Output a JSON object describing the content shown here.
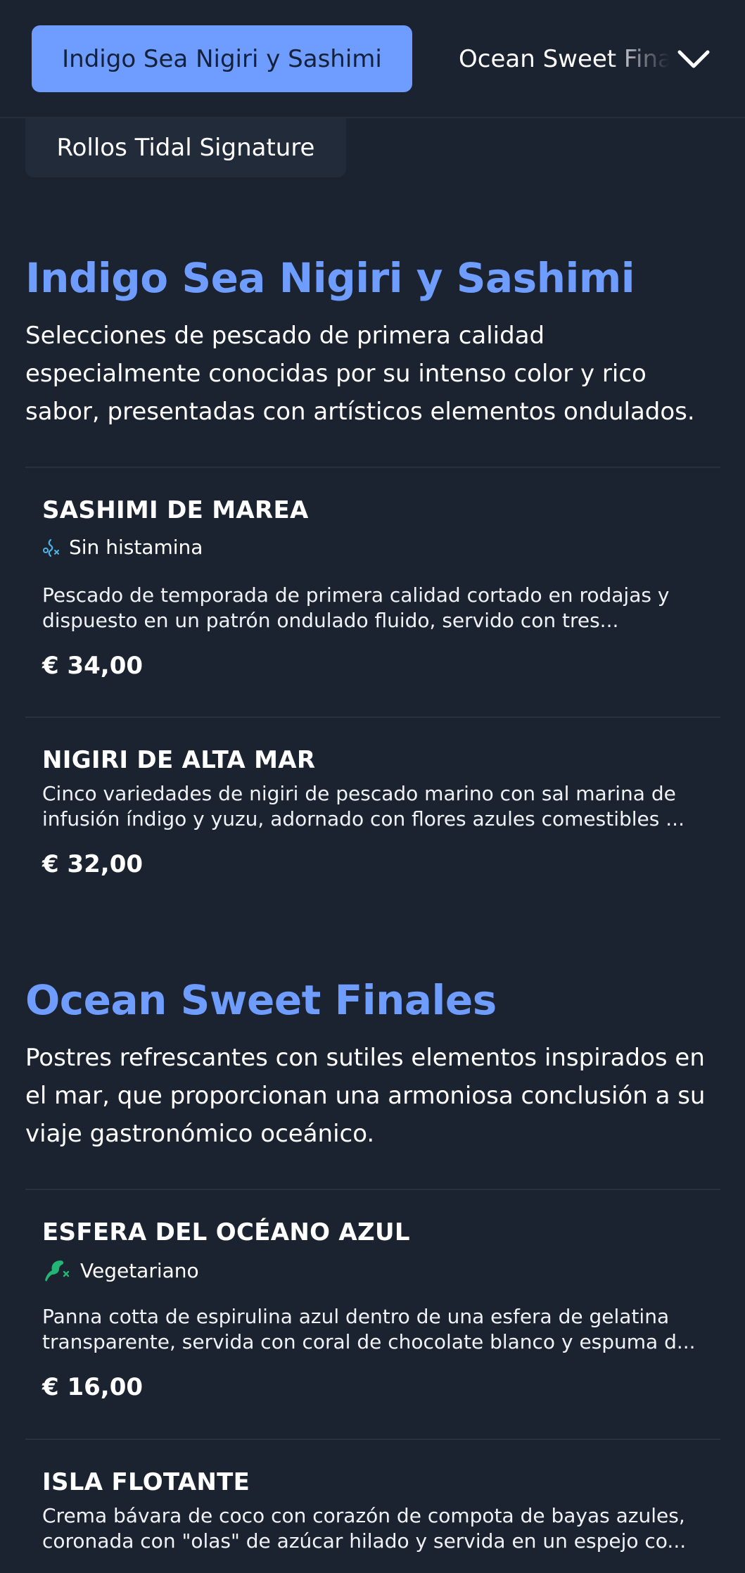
{
  "nav": {
    "active_label": "Indigo Sea Nigiri y Sashimi",
    "next_label": "Ocean Sweet Finales",
    "second_row_label": "Rollos Tidal Signature"
  },
  "sections": [
    {
      "title": "Indigo Sea Nigiri y Sashimi",
      "description_lines": [
        "Selecciones de pescado de primera calidad",
        "especialmente conocidas por su intenso color y rico",
        "sabor, presentadas con artísticos elementos ondulados."
      ],
      "items": [
        {
          "name": "SASHIMI DE MAREA",
          "tag": "Sin histamina",
          "tag_icon": "histamine-free-icon",
          "description_lines": [
            "Pescado de temporada de primera calidad cortado en rodajas y",
            "dispuesto en un patrón ondulado fluido, servido con tres..."
          ],
          "price": "€ 34,00"
        },
        {
          "name": "NIGIRI DE ALTA MAR",
          "description_lines": [
            "Cinco variedades de nigiri de pescado marino con sal marina de",
            "infusión índigo y yuzu, adornado con flores azules comestibles ..."
          ],
          "price": "€ 32,00"
        }
      ]
    },
    {
      "title": "Ocean Sweet Finales",
      "description_lines": [
        "Postres refrescantes con sutiles elementos inspirados en",
        "el mar, que proporcionan una armoniosa conclusión a su",
        "viaje gastronómico oceánico."
      ],
      "items": [
        {
          "name": "ESFERA DEL OCÉANO AZUL",
          "tag": "Vegetariano",
          "tag_icon": "vegetarian-icon",
          "description_lines": [
            "Panna cotta de espirulina azul dentro de una esfera de gelatina",
            "transparente, servida con coral de chocolate blanco y espuma d..."
          ],
          "price": "€ 16,00"
        },
        {
          "name": "ISLA FLOTANTE",
          "description_lines": [
            "Crema bávara de coco con corazón de compota de bayas azules,",
            "coronada con \"olas\" de azúcar hilado y servida en un espejo co..."
          ]
        }
      ]
    }
  ],
  "colors": {
    "background": "#1c2330",
    "accent": "#6f9cff",
    "histamine_icon": "#4fb3e6",
    "vegetarian_icon": "#22b573"
  }
}
